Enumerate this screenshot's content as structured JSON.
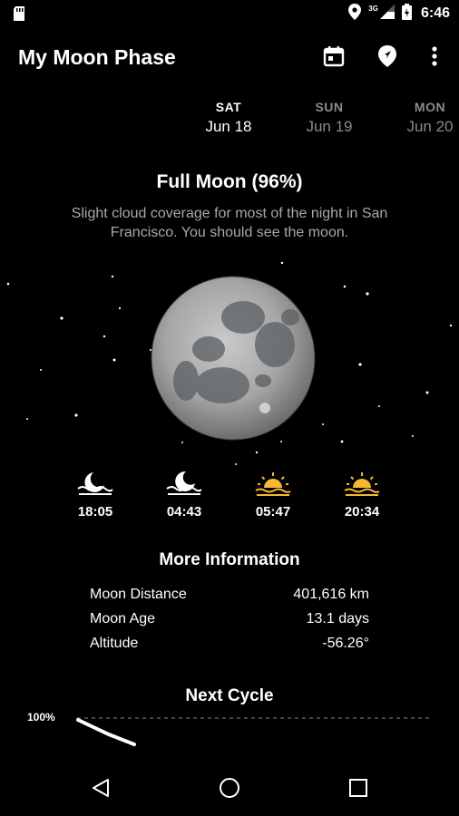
{
  "status_bar": {
    "time": "6:46",
    "network": "3G"
  },
  "app_bar": {
    "title": "My Moon Phase",
    "actions": [
      "calendar-icon",
      "location-pin-icon",
      "more-vert-icon"
    ]
  },
  "days": [
    {
      "dow": "SAT",
      "date": "Jun 18",
      "selected": true
    },
    {
      "dow": "SUN",
      "date": "Jun 19",
      "selected": false
    },
    {
      "dow": "MON",
      "date": "Jun 20",
      "selected": false
    }
  ],
  "phase": {
    "title": "Full Moon (96%)",
    "description": "Slight cloud coverage for most of the night in San Francisco. You should see the moon."
  },
  "times": [
    {
      "icon": "moonrise-icon",
      "value": "18:05"
    },
    {
      "icon": "moonset-icon",
      "value": "04:43"
    },
    {
      "icon": "sunrise-icon",
      "value": "05:47"
    },
    {
      "icon": "sunset-icon",
      "value": "20:34"
    }
  ],
  "more_info": {
    "title": "More Information",
    "rows": [
      {
        "label": "Moon Distance",
        "value": "401,616 km"
      },
      {
        "label": "Moon Age",
        "value": "13.1 days"
      },
      {
        "label": "Altitude",
        "value": "-56.26°"
      }
    ]
  },
  "next_cycle": {
    "title": "Next Cycle",
    "axis_label": "100%"
  },
  "colors": {
    "background": "#000000",
    "sun_icon": "#f7b731",
    "muted_text": "#a8a8a8"
  }
}
